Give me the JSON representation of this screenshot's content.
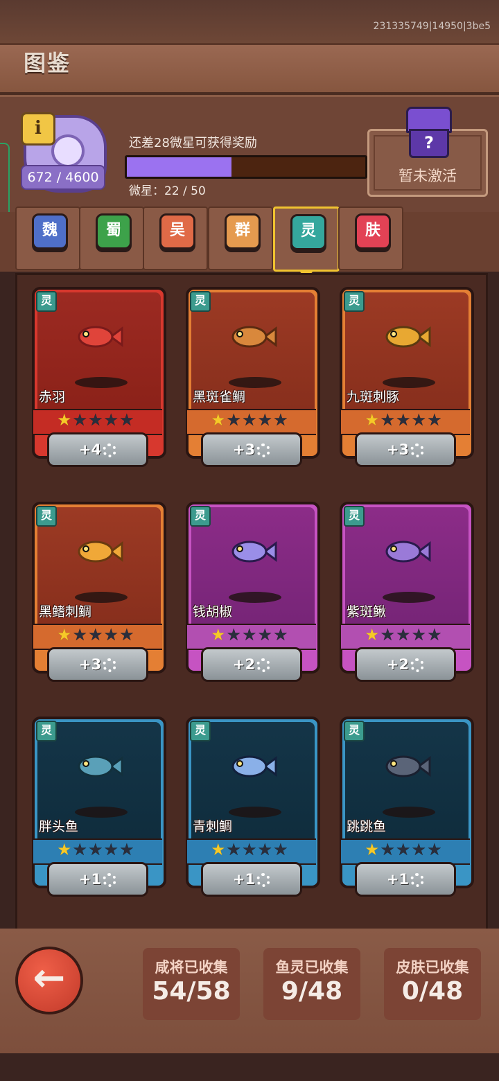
{
  "debug_id": "231335749|14950|3be5",
  "title": "图鉴",
  "header": {
    "badge_count": "672 / 4600",
    "info_icon": "i",
    "reward_text": "还差28微星可获得奖励",
    "progress": {
      "current": 22,
      "max": 50
    },
    "star_text": "微星：22 / 50",
    "chest_icon_glyph": "?",
    "chest_label": "暂未激活"
  },
  "tabs": [
    {
      "label": "魏",
      "color": "#4f6fc9",
      "active": false
    },
    {
      "label": "蜀",
      "color": "#3da24a",
      "active": false
    },
    {
      "label": "吴",
      "color": "#e06a47",
      "active": false
    },
    {
      "label": "群",
      "color": "#e59a4f",
      "active": false
    },
    {
      "label": "灵",
      "color": "#35a79d",
      "active": true
    },
    {
      "label": "肤",
      "color": "#e24255",
      "active": false
    }
  ],
  "cards": [
    {
      "name": "赤羽",
      "tag": "灵",
      "rarity": "red",
      "stars": 1,
      "button": "+4",
      "fish_icon": "red-fish-icon"
    },
    {
      "name": "黑斑雀鲷",
      "tag": "灵",
      "rarity": "orange",
      "stars": 1,
      "button": "+3",
      "fish_icon": "lionfish-icon"
    },
    {
      "name": "九斑刺豚",
      "tag": "灵",
      "rarity": "orange",
      "stars": 1,
      "button": "+3",
      "fish_icon": "pufferfish-icon"
    },
    {
      "name": "黑鳍刺鲷",
      "tag": "灵",
      "rarity": "orange",
      "stars": 1,
      "button": "+3",
      "fish_icon": "spiny-fish-icon"
    },
    {
      "name": "钱胡椒",
      "tag": "灵",
      "rarity": "purple",
      "stars": 1,
      "button": "+2",
      "fish_icon": "fish-school-icon"
    },
    {
      "name": "紫斑鳅",
      "tag": "灵",
      "rarity": "purple",
      "stars": 1,
      "button": "+2",
      "fish_icon": "catfish-icon"
    },
    {
      "name": "胖头鱼",
      "tag": "灵",
      "rarity": "blue",
      "stars": 1,
      "button": "+1",
      "fish_icon": "round-fish-icon"
    },
    {
      "name": "青刺鲷",
      "tag": "灵",
      "rarity": "blue",
      "stars": 1,
      "button": "+1",
      "fish_icon": "blue-spiny-fish-icon"
    },
    {
      "name": "跳跳鱼",
      "tag": "灵",
      "rarity": "blue",
      "stars": 1,
      "button": "+1",
      "fish_icon": "mudskipper-icon"
    }
  ],
  "footer": {
    "back_glyph": "←",
    "stats": [
      {
        "label": "咸将已收集",
        "value": "54/58"
      },
      {
        "label": "鱼灵已收集",
        "value": "9/48"
      },
      {
        "label": "皮肤已收集",
        "value": "0/48"
      }
    ]
  },
  "colors": {
    "accent_purple": "#9b72f0",
    "star_on": "#f6c928"
  }
}
